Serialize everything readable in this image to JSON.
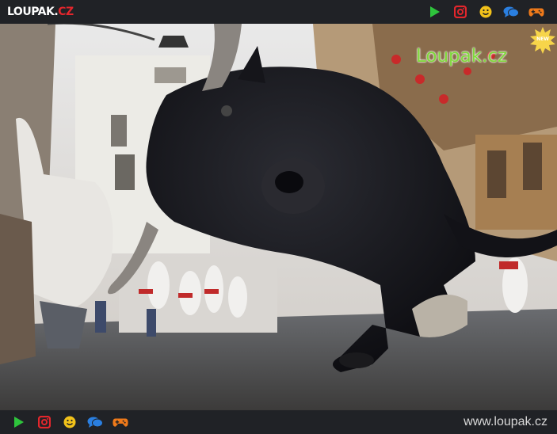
{
  "header": {
    "logo_main": "LOUPAK.",
    "logo_cz": "CZ"
  },
  "icons": [
    "play-icon",
    "instagram-icon",
    "smiley-icon",
    "chat-icon",
    "gamepad-icon"
  ],
  "watermark": {
    "text": "Loupak.cz",
    "badge": "NEW"
  },
  "footer": {
    "url": "www.loupak.cz"
  },
  "colors": {
    "play": "#2ec43c",
    "instagram": "#e3262c",
    "smiley": "#f2c21a",
    "chat": "#2a7fe0",
    "gamepad": "#ef7a1a",
    "watermark": "#7fd83a"
  }
}
